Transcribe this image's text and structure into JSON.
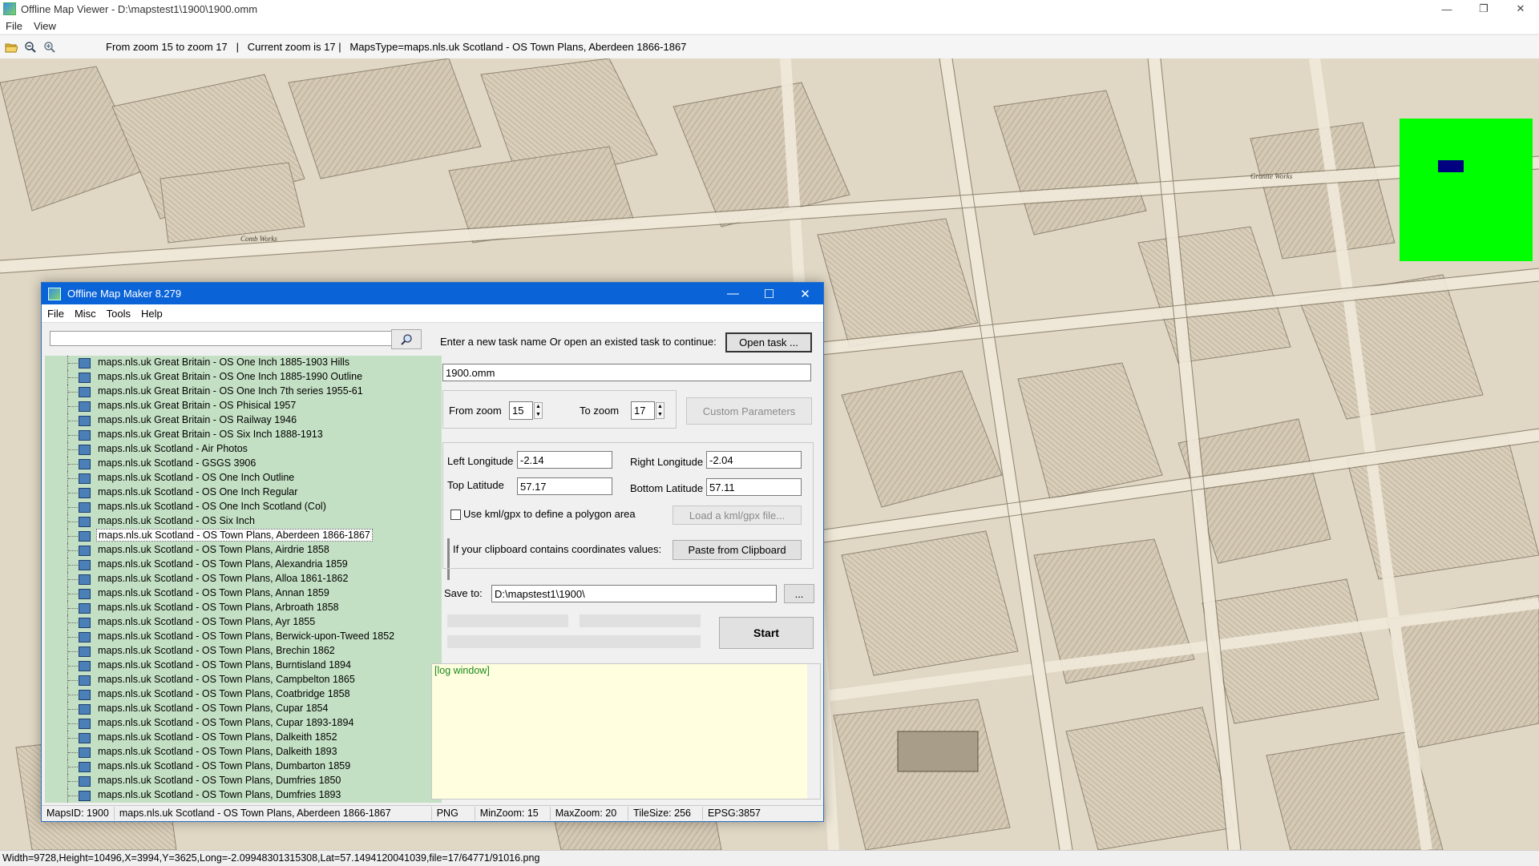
{
  "viewer": {
    "title": "Offline Map Viewer - D:\\mapstest1\\1900\\1900.omm",
    "menu": [
      "File",
      "View"
    ],
    "toolbar_text": "From zoom 15 to zoom 17   |   Current zoom is 17 |   MapsType=maps.nls.uk Scotland - OS Town Plans, Aberdeen 1866-1867",
    "status": "Width=9728,Height=10496,X=3994,Y=3625,Long=-2.09948301315308,Lat=57.1494120041039,file=17/64771/91016.png",
    "window_controls": [
      "—",
      "❐",
      "✕"
    ]
  },
  "dialog": {
    "title": "Offline Map Maker 8.279",
    "menu": [
      "File",
      "Misc",
      "Tools",
      "Help"
    ],
    "search": {
      "value": "",
      "placeholder": ""
    },
    "maps_list": [
      "maps.nls.uk Great Britain - OS One Inch 1885-1903 Hills",
      "maps.nls.uk Great Britain - OS One Inch 1885-1990 Outline",
      "maps.nls.uk Great Britain - OS One Inch 7th series 1955-61",
      "maps.nls.uk Great Britain - OS Phisical 1957",
      "maps.nls.uk Great Britain - OS Railway 1946",
      "maps.nls.uk Great Britain - OS Six Inch 1888-1913",
      "maps.nls.uk Scotland - Air Photos",
      "maps.nls.uk Scotland - GSGS 3906",
      "maps.nls.uk Scotland - OS One Inch Outline",
      "maps.nls.uk Scotland - OS One Inch Regular",
      "maps.nls.uk Scotland - OS One Inch Scotland (Col)",
      "maps.nls.uk Scotland - OS Six Inch",
      "maps.nls.uk Scotland - OS Town Plans, Aberdeen 1866-1867",
      "maps.nls.uk Scotland - OS Town Plans, Airdrie 1858",
      "maps.nls.uk Scotland - OS Town Plans, Alexandria 1859",
      "maps.nls.uk Scotland - OS Town Plans, Alloa 1861-1862",
      "maps.nls.uk Scotland - OS Town Plans, Annan 1859",
      "maps.nls.uk Scotland - OS Town Plans, Arbroath 1858",
      "maps.nls.uk Scotland - OS Town Plans, Ayr 1855",
      "maps.nls.uk Scotland - OS Town Plans, Berwick-upon-Tweed 1852",
      "maps.nls.uk Scotland - OS Town Plans, Brechin 1862",
      "maps.nls.uk Scotland - OS Town Plans, Burntisland 1894",
      "maps.nls.uk Scotland - OS Town Plans, Campbelton 1865",
      "maps.nls.uk Scotland - OS Town Plans, Coatbridge 1858",
      "maps.nls.uk Scotland - OS Town Plans, Cupar 1854",
      "maps.nls.uk Scotland - OS Town Plans, Cupar 1893-1894",
      "maps.nls.uk Scotland - OS Town Plans, Dalkeith 1852",
      "maps.nls.uk Scotland - OS Town Plans, Dalkeith 1893",
      "maps.nls.uk Scotland - OS Town Plans, Dumbarton 1859",
      "maps.nls.uk Scotland - OS Town Plans, Dumfries 1850",
      "maps.nls.uk Scotland - OS Town Plans, Dumfries 1893"
    ],
    "selected_map_index": 12,
    "task_prompt": "Enter a new task name Or open an existed task to continue:",
    "open_task_label": "Open task ...",
    "task_name": "1900.omm",
    "from_zoom_label": "From zoom",
    "from_zoom": "15",
    "to_zoom_label": "To zoom",
    "to_zoom": "17",
    "custom_params_label": "Custom Parameters",
    "left_lon_label": "Left Longitude",
    "left_lon": "-2.14",
    "right_lon_label": "Right Longitude",
    "right_lon": "-2.04",
    "top_lat_label": "Top Latitude",
    "top_lat": "57.17",
    "bottom_lat_label": "Bottom Latitude",
    "bottom_lat": "57.11",
    "kml_label": "Use kml/gpx to define a polygon area",
    "load_kml_label": "Load a kml/gpx file...",
    "clipboard_label": "If your clipboard contains coordinates values:",
    "paste_label": "Paste from Clipboard",
    "save_to_label": "Save to:",
    "save_to": "D:\\mapstest1\\1900\\",
    "browse_label": "...",
    "start_label": "Start",
    "log_text": "[log window]",
    "status": {
      "maps_id": "MapsID: 1900",
      "map_name": "maps.nls.uk Scotland - OS Town Plans, Aberdeen 1866-1867",
      "format": "PNG",
      "min_zoom": "MinZoom: 15",
      "max_zoom": "MaxZoom: 20",
      "tile_size": "TileSize: 256",
      "epsg": "EPSG:3857"
    },
    "window_controls": [
      "—",
      "☐",
      "✕"
    ]
  },
  "colors": {
    "titlebar": "#0a64d8",
    "tree_bg": "#c4e0c4",
    "log_bg": "#ffffe0",
    "minimap": "#00ff00",
    "minimap_viewport": "#000080",
    "map_paper": "#ddd3c0"
  },
  "map_labels": [
    "Comb Works",
    "Granite Works"
  ]
}
